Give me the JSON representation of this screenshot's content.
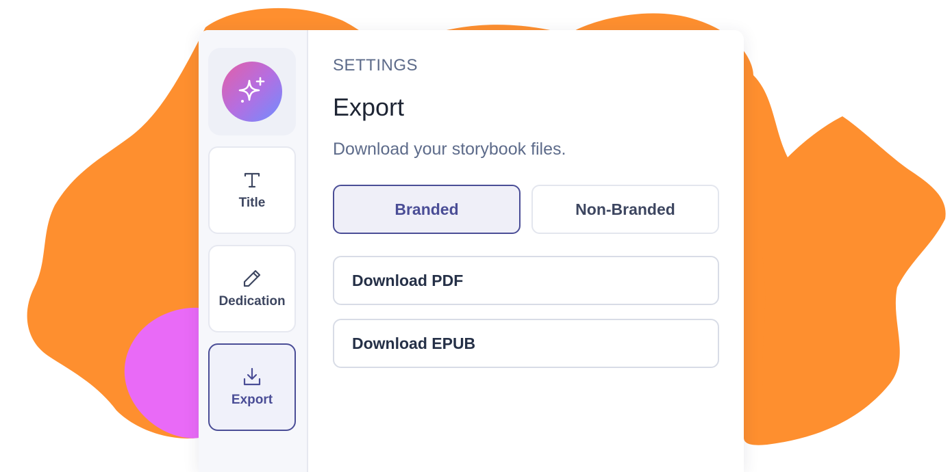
{
  "sidebar": {
    "logo_icon": "sparkles-icon",
    "items": [
      {
        "label": "Title",
        "icon": "text-icon",
        "active": false
      },
      {
        "label": "Dedication",
        "icon": "pencil-icon",
        "active": false
      },
      {
        "label": "Export",
        "icon": "download-icon",
        "active": true
      }
    ]
  },
  "main": {
    "eyebrow": "SETTINGS",
    "title": "Export",
    "description": "Download your storybook files.",
    "toggle": {
      "options": [
        "Branded",
        "Non-Branded"
      ],
      "selected": "Branded"
    },
    "downloads": [
      {
        "label": "Download PDF"
      },
      {
        "label": "Download EPUB"
      }
    ]
  },
  "colors": {
    "accent": "#4a4d96",
    "splash_orange": "#fe8f2f",
    "splash_pink": "#e96af7",
    "logo_gradient": [
      "#e35fa6",
      "#6f8dff"
    ]
  }
}
